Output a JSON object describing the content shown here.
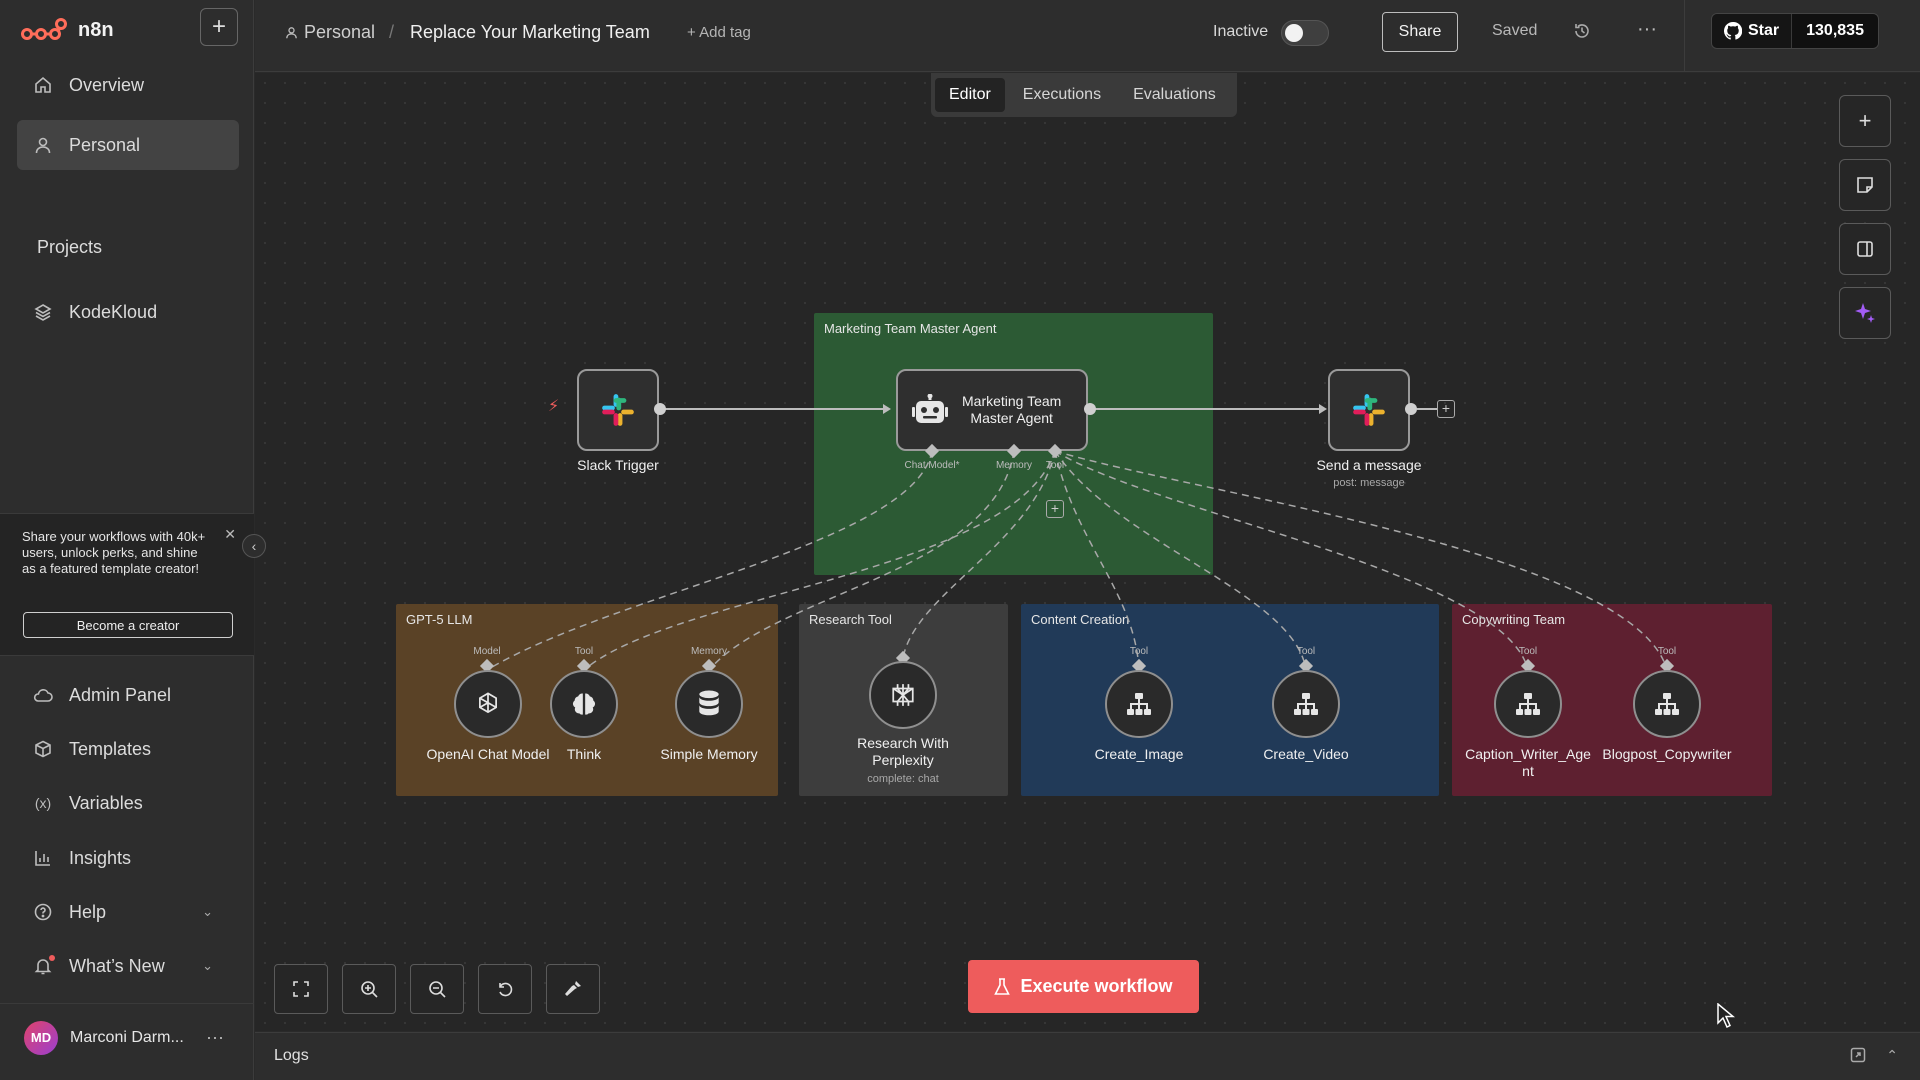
{
  "brand": {
    "name": "n8n",
    "accent": "#ff6d5a"
  },
  "sidebar": {
    "nav_top": [
      {
        "label": "Overview",
        "icon": "home-icon"
      },
      {
        "label": "Personal",
        "icon": "user-icon",
        "active": true
      }
    ],
    "projects_title": "Projects",
    "projects": [
      {
        "label": "KodeKloud",
        "icon": "layers-icon"
      }
    ],
    "promo": {
      "text": "Share your workflows with 40k+ users, unlock perks, and shine as a featured template creator!",
      "button": "Become a creator"
    },
    "nav_bottom": [
      {
        "label": "Admin Panel",
        "icon": "cloud-icon"
      },
      {
        "label": "Templates",
        "icon": "box-icon"
      },
      {
        "label": "Variables",
        "icon": "variable-icon"
      },
      {
        "label": "Insights",
        "icon": "chart-icon"
      },
      {
        "label": "Help",
        "icon": "help-icon"
      },
      {
        "label": "What’s New",
        "icon": "bell-icon"
      }
    ],
    "user": {
      "initials": "MD",
      "name": "Marconi Darm..."
    }
  },
  "header": {
    "breadcrumb_project": "Personal",
    "breadcrumb_sep": "/",
    "workflow_title": "Replace Your Marketing Team",
    "add_tag": "+ Add tag",
    "status_label": "Inactive",
    "share": "Share",
    "saved": "Saved",
    "github": {
      "star": "Star",
      "count": "130,835"
    }
  },
  "tabs": [
    {
      "label": "Editor",
      "active": true
    },
    {
      "label": "Executions"
    },
    {
      "label": "Evaluations"
    }
  ],
  "groups": {
    "master": {
      "label": "Marketing Team Master Agent",
      "color": "#2c5a34"
    },
    "llm": {
      "label": "GPT-5 LLM",
      "color": "#5a4226"
    },
    "research": {
      "label": "Research Tool",
      "color": "#3d3d3d"
    },
    "content": {
      "label": "Content Creation",
      "color": "#213a58"
    },
    "copy": {
      "label": "Copywriting Team",
      "color": "#5e2030"
    }
  },
  "nodes": {
    "slack_trigger": {
      "label": "Slack Trigger"
    },
    "agent": {
      "label_line1": "Marketing Team",
      "label_line2": "Master Agent",
      "ports": [
        "Chat Model*",
        "Memory",
        "Tool"
      ]
    },
    "send_message": {
      "label": "Send a message",
      "sub": "post: message"
    },
    "openai": {
      "label": "OpenAI Chat Model",
      "port": "Model"
    },
    "think": {
      "label": "Think",
      "port": "Tool"
    },
    "memory": {
      "label": "Simple Memory",
      "port": "Memory"
    },
    "perplexity": {
      "label_line1": "Research With",
      "label_line2": "Perplexity",
      "sub": "complete: chat"
    },
    "create_image": {
      "label": "Create_Image",
      "port": "Tool"
    },
    "create_video": {
      "label": "Create_Video",
      "port": "Tool"
    },
    "caption": {
      "label_line1": "Caption_Writer_Age",
      "label_line2": "nt",
      "port": "Tool"
    },
    "blogpost": {
      "label": "Blogpost_Copywriter",
      "port": "Tool"
    }
  },
  "execute_button": "Execute workflow",
  "logs": {
    "label": "Logs"
  }
}
